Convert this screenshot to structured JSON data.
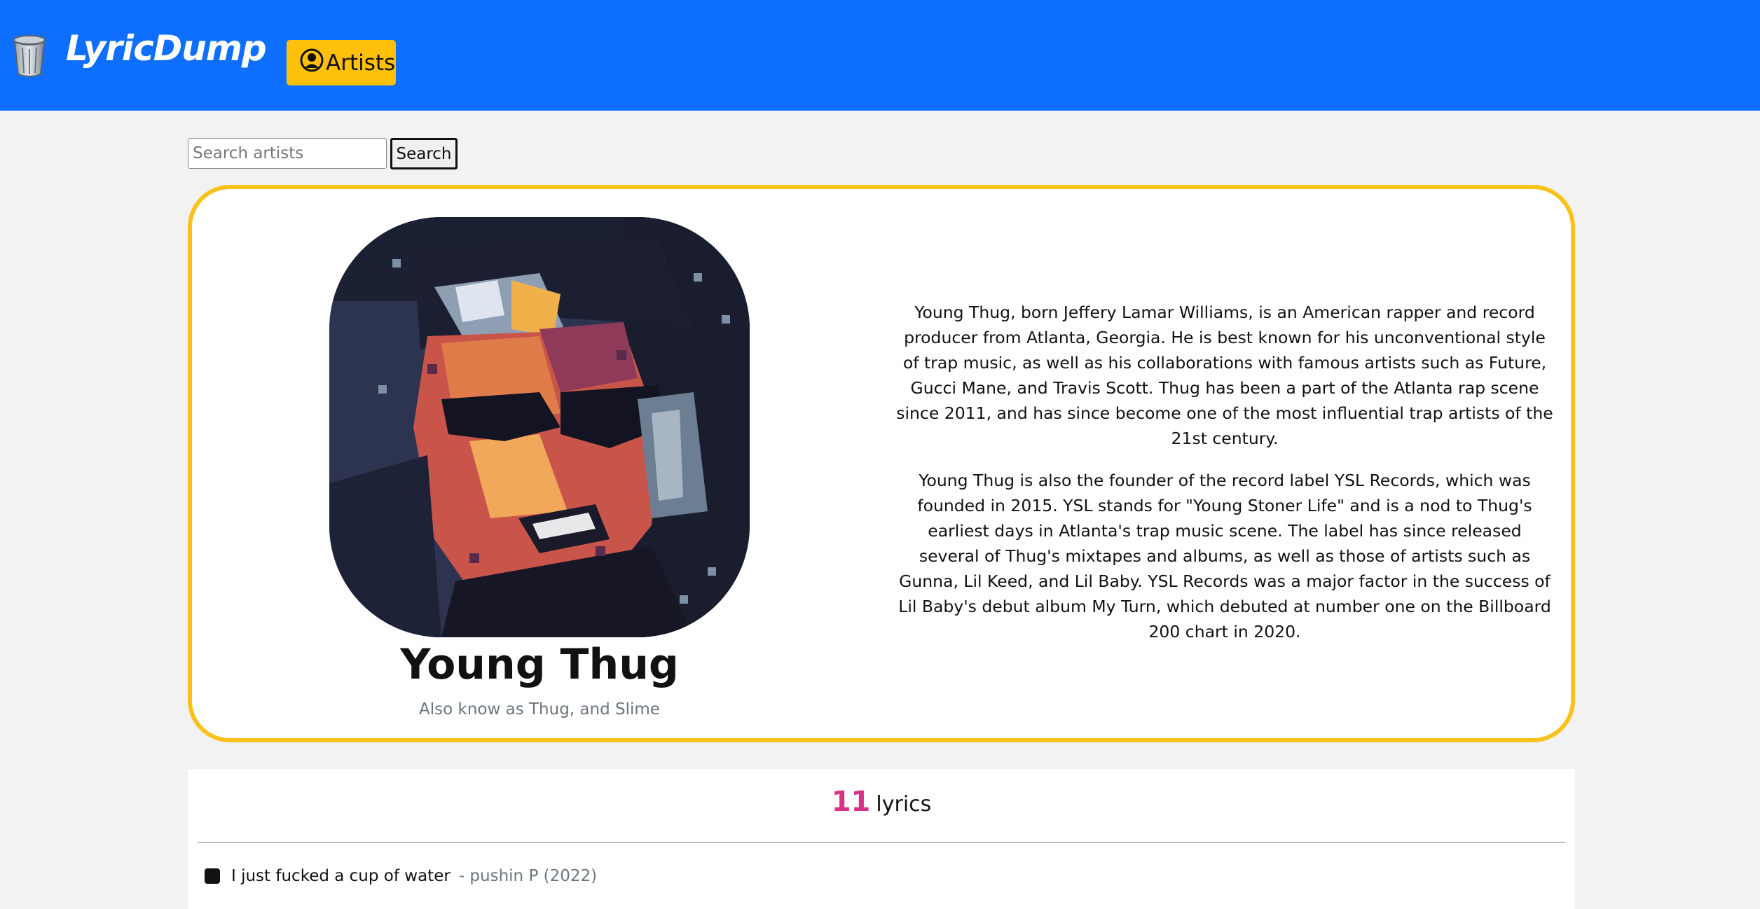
{
  "navbar": {
    "brand": "LyricDump",
    "logo_icon": "trash-can-icon",
    "artists_label": "Artists",
    "artists_icon": "user-circle-icon",
    "background": "#0e6ffe",
    "accent": "#fec00b"
  },
  "search": {
    "placeholder": "Search artists",
    "value": "",
    "button_label": "Search"
  },
  "artist": {
    "name": "Young Thug",
    "aka": "Also know as Thug, and Slime",
    "bio": [
      "Young Thug, born Jeffery Lamar Williams, is an American rapper and record producer from Atlanta, Georgia. He is best known for his unconventional style of trap music, as well as his collaborations with famous artists such as Future, Gucci Mane, and Travis Scott. Thug has been a part of the Atlanta rap scene since 2011, and has since become one of the most influential trap artists of the 21st century.",
      "Young Thug is also the founder of the record label YSL Records, which was founded in 2015. YSL stands for \"Young Stoner Life\" and is a nod to Thug's earliest days in Atlanta's trap music scene. The label has since released several of Thug's mixtapes and albums, as well as those of artists such as Gunna, Lil Keed, and Lil Baby. YSL Records was a major factor in the success of Lil Baby's debut album My Turn, which debuted at number one on the Billboard 200 chart in 2020."
    ],
    "card_border_color": "#f8c21b"
  },
  "lyrics": {
    "count": "11",
    "count_label": "lyrics",
    "count_color": "#d63384",
    "items": [
      {
        "text": "I just fucked a cup of water",
        "meta": "- pushin P (2022)"
      }
    ]
  }
}
